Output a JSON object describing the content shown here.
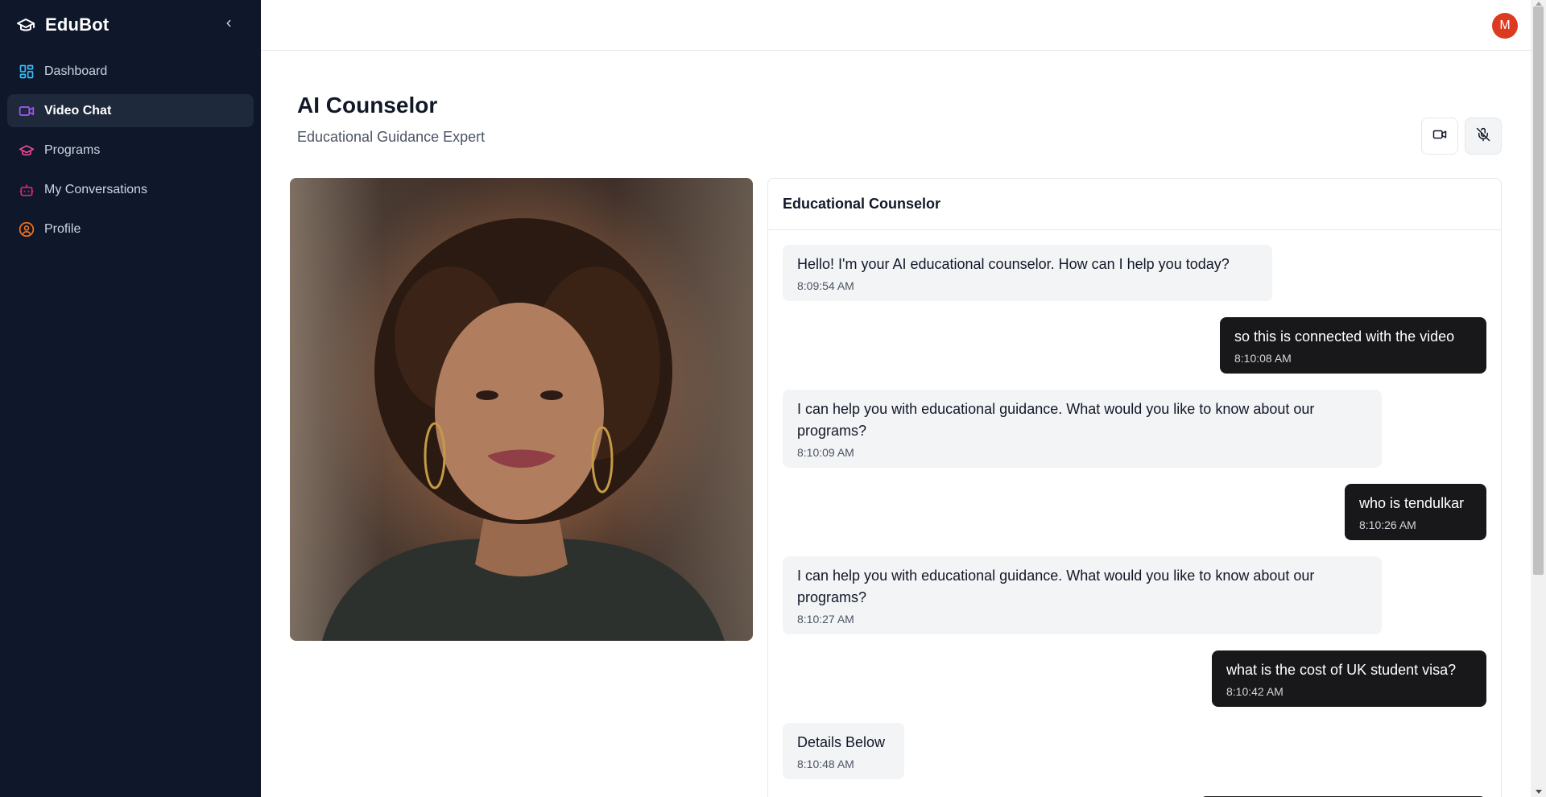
{
  "app": {
    "name": "EduBot",
    "accent_colors": {
      "dashboard": "#38bdf8",
      "video_chat": "#a855f7",
      "programs": "#ec4899",
      "conversations": "#db2777",
      "profile": "#f97316"
    }
  },
  "sidebar": {
    "items": [
      {
        "label": "Dashboard",
        "icon": "dashboard-icon"
      },
      {
        "label": "Video Chat",
        "icon": "video-icon",
        "active": true
      },
      {
        "label": "Programs",
        "icon": "graduation-cap-icon"
      },
      {
        "label": "My Conversations",
        "icon": "bot-icon"
      },
      {
        "label": "Profile",
        "icon": "user-circle-icon"
      }
    ]
  },
  "topbar": {
    "avatar_initial": "M"
  },
  "header": {
    "title": "AI Counselor",
    "subtitle": "Educational Guidance Expert"
  },
  "chat": {
    "title": "Educational Counselor",
    "messages": [
      {
        "role": "bot",
        "text": "Hello! I'm your AI educational counselor. How can I help you today?",
        "time": "8:09:54 AM"
      },
      {
        "role": "user",
        "text": "so this is connected with the video",
        "time": "8:10:08 AM"
      },
      {
        "role": "bot",
        "text": "I can help you with educational guidance. What would you like to know about our programs?",
        "time": "8:10:09 AM"
      },
      {
        "role": "user",
        "text": "who is tendulkar",
        "time": "8:10:26 AM"
      },
      {
        "role": "bot",
        "text": "I can help you with educational guidance. What would you like to know about our programs?",
        "time": "8:10:27 AM"
      },
      {
        "role": "user",
        "text": "what is the cost of UK student visa?",
        "time": "8:10:42 AM"
      },
      {
        "role": "bot",
        "text": "Details Below",
        "time": "8:10:48 AM"
      }
    ]
  }
}
